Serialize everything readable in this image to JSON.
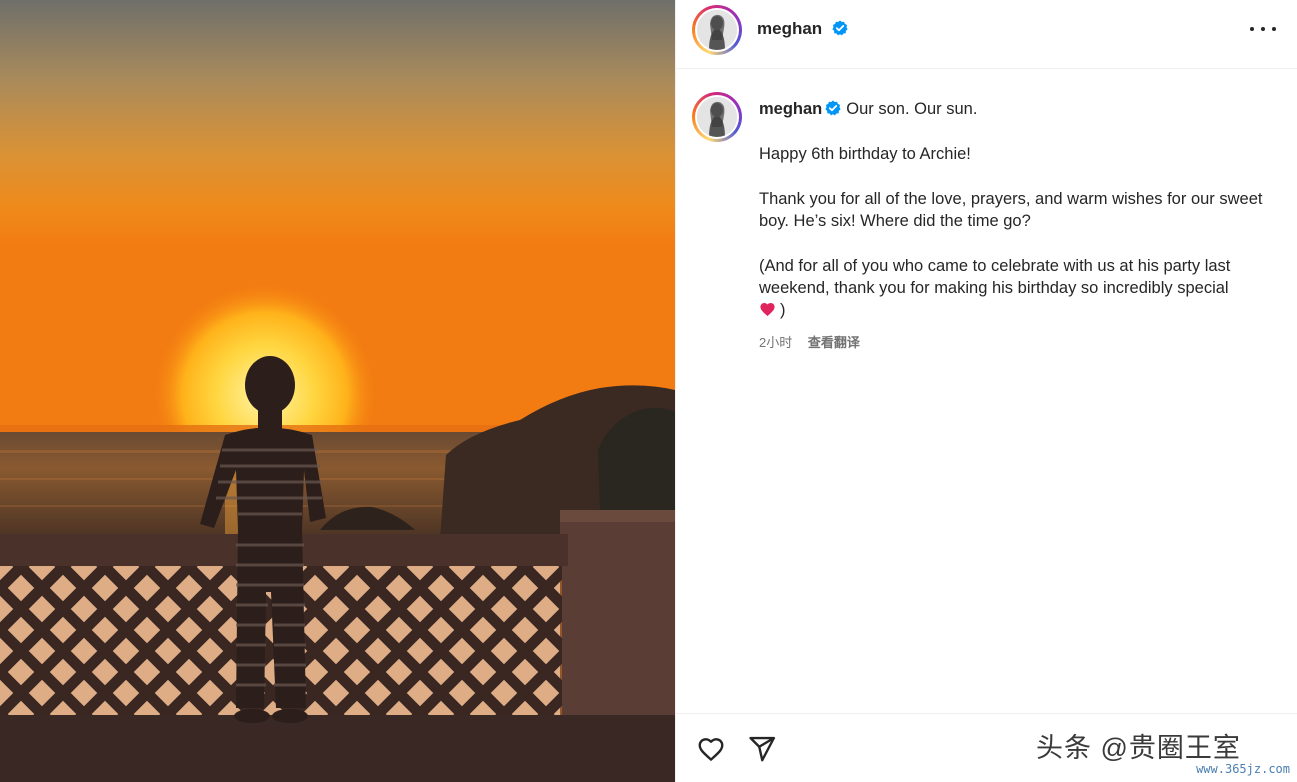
{
  "post": {
    "username": "meghan",
    "verified": true,
    "more_icon": "more-horizontal-icon"
  },
  "caption": {
    "username": "meghan",
    "headline": "Our son. Our sun.",
    "line1": "Happy 6th birthday to Archie!",
    "line2": "Thank you for all of the love, prayers, and warm wishes for our sweet boy. He’s six! Where did the time go?",
    "line3": "(And for all of you who came to celebrate with us at his party last weekend, thank you for making his birthday so incredibly special",
    "line3_end": ")",
    "emoji": "red-heart-emoji"
  },
  "meta": {
    "time": "2小时",
    "translate": "查看翻译"
  },
  "actions": {
    "like_icon": "heart-outline-icon",
    "share_icon": "paper-plane-icon"
  },
  "watermark": {
    "text": "头条 @贵圈王室",
    "url": "www.365jz.com"
  },
  "colors": {
    "verified_blue": "#0095f6",
    "sunset_orange": "#f08a1c",
    "heart_red": "#e0245e"
  }
}
